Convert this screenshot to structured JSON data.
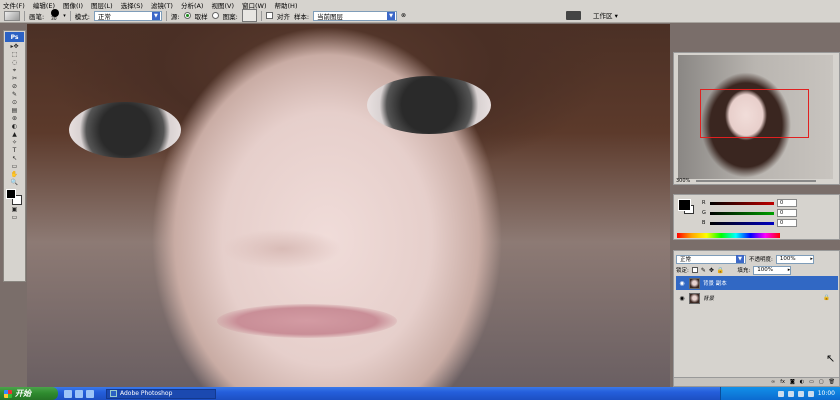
{
  "menubar": {
    "items": [
      "文件(F)",
      "编辑(E)",
      "图像(I)",
      "图层(L)",
      "选择(S)",
      "滤镜(T)",
      "分析(A)",
      "视图(V)",
      "窗口(W)",
      "帮助(H)"
    ]
  },
  "options": {
    "brush_label": "画笔:",
    "brush_size": "30",
    "mode_label": "模式:",
    "mode_value": "正常",
    "source_label": "源:",
    "sampled_label": "取样",
    "pattern_label": "图案:",
    "aligned_label": "对齐",
    "sample_label": "样本:",
    "sample_value": "当前图层",
    "workspace": "工作区 ▾"
  },
  "toolbox": {
    "logo": "Ps",
    "tools": [
      "▸✥",
      "⬚",
      "◌",
      "⌖",
      "✂",
      "⊘",
      "✎",
      "⊙",
      "▤",
      "⊛",
      "◐",
      "▲",
      "✧",
      "T",
      "↖",
      "▭",
      "✋",
      "🔍"
    ]
  },
  "navigator": {
    "zoom": "300%"
  },
  "color": {
    "rows": [
      {
        "label": "R",
        "value": "0",
        "color": "#c00000"
      },
      {
        "label": "G",
        "value": "0",
        "color": "#00a000"
      },
      {
        "label": "B",
        "value": "0",
        "color": "#0000c0"
      }
    ]
  },
  "layers": {
    "blend": "正常",
    "opacity_label": "不透明度:",
    "opacity": "100%",
    "lock_label": "锁定:",
    "fill_label": "填充:",
    "fill": "100%",
    "items": [
      {
        "name": "背景 副本",
        "selected": true
      },
      {
        "name": "背景",
        "selected": false
      }
    ]
  },
  "taskbar": {
    "start": "开始",
    "task": "Adobe Photoshop",
    "clock": "10:00"
  }
}
